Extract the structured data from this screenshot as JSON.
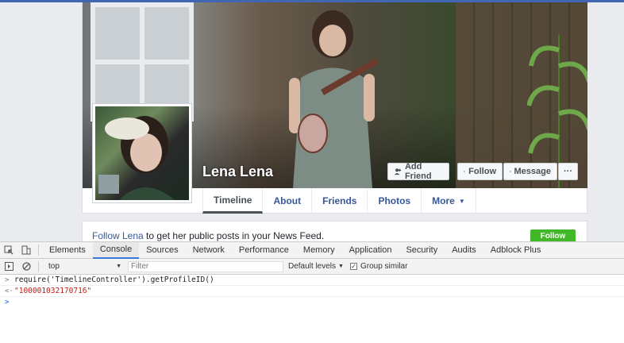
{
  "profile": {
    "name": "Lena Lena",
    "buttons": {
      "add_friend": "Add Friend",
      "follow": "Follow",
      "message": "Message",
      "more": "···"
    },
    "tabs": [
      {
        "label": "Timeline",
        "active": true
      },
      {
        "label": "About"
      },
      {
        "label": "Friends"
      },
      {
        "label": "Photos"
      },
      {
        "label": "More",
        "caret": "▼"
      }
    ]
  },
  "follow_prompt": {
    "link_text": "Follow Lena",
    "rest_text": " to get her public posts in your News Feed.",
    "button": "Follow"
  },
  "devtools": {
    "tabs": [
      "Elements",
      "Console",
      "Sources",
      "Network",
      "Performance",
      "Memory",
      "Application",
      "Security",
      "Audits",
      "Adblock Plus"
    ],
    "active_tab": "Console",
    "context": "top",
    "filter_placeholder": "Filter",
    "levels_label": "Default levels",
    "levels_caret": "▼",
    "group_similar_label": "Group similar",
    "group_similar_checked": true,
    "console_lines": [
      {
        "prefix": ">",
        "text": "require('TimelineController').getProfileID()"
      },
      {
        "prefix": "<·",
        "text": "\"100001032170716\""
      }
    ],
    "prompt_symbol": ">"
  },
  "colors": {
    "brand_blue": "#4267b2",
    "link": "#365899",
    "follow_green": "#42b72a",
    "console_string": "#c41a16"
  }
}
